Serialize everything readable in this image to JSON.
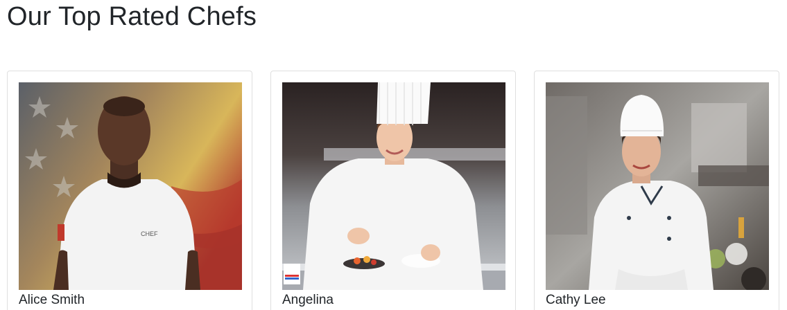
{
  "page": {
    "title": "Our Top Rated Chefs"
  },
  "chefs": [
    {
      "name": "Alice Smith",
      "photo_icon": "chef-photo-flag-background"
    },
    {
      "name": "Angelina",
      "photo_icon": "chef-photo-kitchen-toque"
    },
    {
      "name": "Cathy Lee",
      "photo_icon": "chef-photo-restaurant-kitchen"
    }
  ],
  "colors": {
    "text": "#212529",
    "card_border": "#dfdfdf",
    "chef_coat": "#f4f4f4"
  }
}
